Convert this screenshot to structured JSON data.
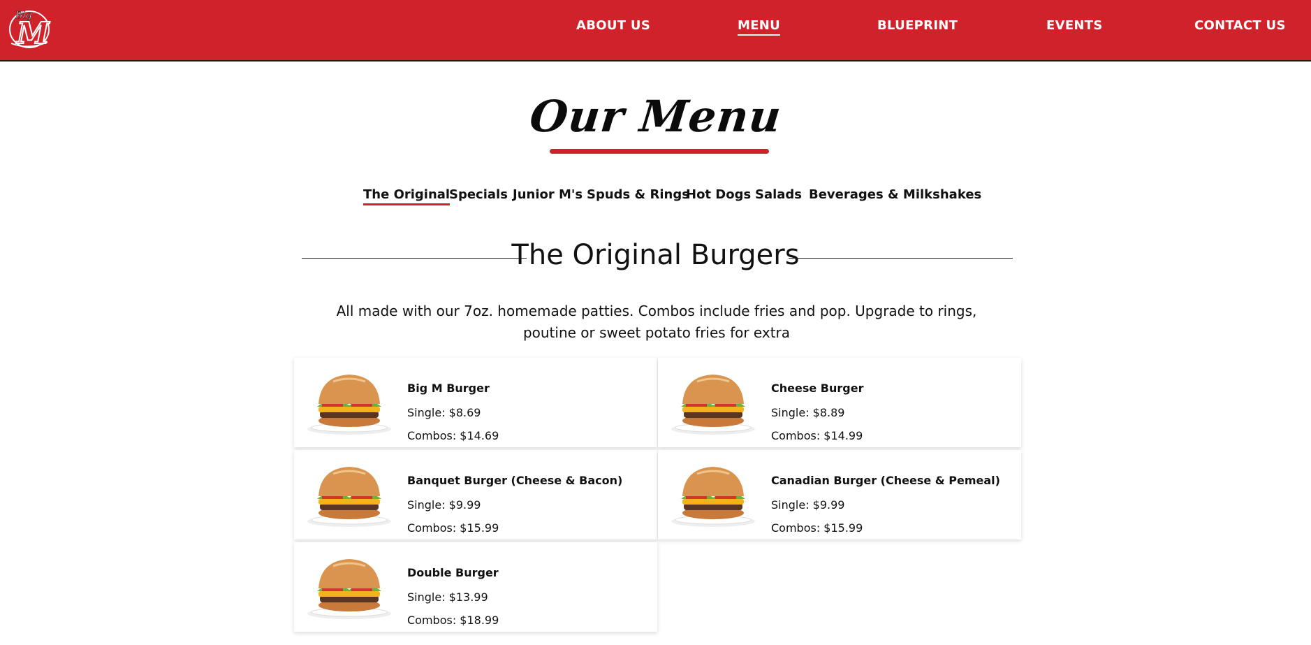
{
  "brand": {
    "logo_icon": "big-m-logo-icon",
    "logo_text": "Big M",
    "accent_color": "#d0222a"
  },
  "nav": {
    "items": [
      {
        "label": "ABOUT US"
      },
      {
        "label": "MENU",
        "active": true
      },
      {
        "label": "BLUEPRINT"
      },
      {
        "label": "EVENTS"
      },
      {
        "label": "CONTACT US"
      }
    ]
  },
  "page": {
    "title": "Our Menu"
  },
  "tabs": [
    {
      "label": "The Original",
      "active": true
    },
    {
      "label": "Specials"
    },
    {
      "label": "Junior M's"
    },
    {
      "label": "Spuds & Rings"
    },
    {
      "label": "Hot Dogs"
    },
    {
      "label": "Salads"
    },
    {
      "label": "Beverages & Milkshakes"
    }
  ],
  "section": {
    "title": "The Original Burgers",
    "description": "All made with our 7oz. homemade patties. Combos include fries and pop. Upgrade to rings, poutine or sweet potato fries for extra"
  },
  "items": [
    {
      "name": "Big M Burger",
      "single": "Single: $8.69",
      "combo": "Combos: $14.69",
      "image_icon": "burger-image"
    },
    {
      "name": "Cheese Burger",
      "single": "Single: $8.89",
      "combo": "Combos: $14.99",
      "image_icon": "burger-image"
    },
    {
      "name": "Banquet Burger (Cheese & Bacon)",
      "single": "Single: $9.99",
      "combo": "Combos: $15.99",
      "image_icon": "burger-image"
    },
    {
      "name": "Canadian Burger (Cheese & Pemeal)",
      "single": "Single: $9.99",
      "combo": "Combos: $15.99",
      "image_icon": "burger-image"
    },
    {
      "name": "Double Burger",
      "single": "Single: $13.99",
      "combo": "Combos: $18.99",
      "image_icon": "burger-image"
    }
  ]
}
